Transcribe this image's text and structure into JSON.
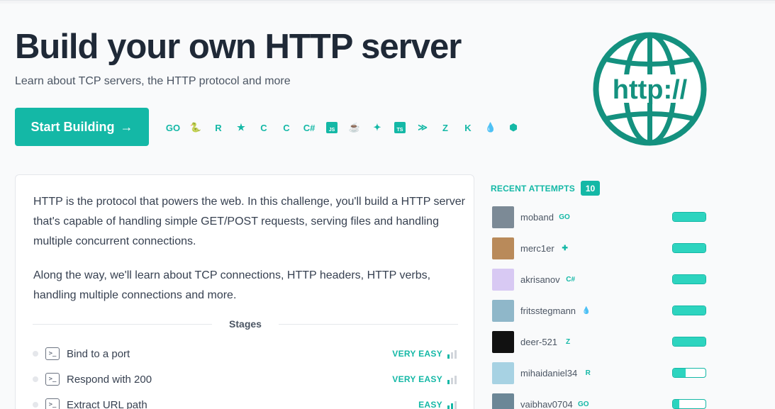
{
  "hero": {
    "title": "Build your own HTTP server",
    "subtitle": "Learn about TCP servers, the HTTP protocol and more",
    "start_button": "Start Building",
    "start_arrow": "→",
    "logo_text": "http://"
  },
  "languages": [
    {
      "name": "go-icon",
      "glyph": "GO"
    },
    {
      "name": "python-icon",
      "glyph": "🐍"
    },
    {
      "name": "rust-icon",
      "glyph": "R"
    },
    {
      "name": "haskell-icon",
      "glyph": "★"
    },
    {
      "name": "c-icon",
      "glyph": "C"
    },
    {
      "name": "cpp-icon",
      "glyph": "C"
    },
    {
      "name": "csharp-icon",
      "glyph": "C#"
    },
    {
      "name": "javascript-icon",
      "glyph": "JS"
    },
    {
      "name": "java-icon",
      "glyph": "☕"
    },
    {
      "name": "kotlin-leaf-icon",
      "glyph": "✦"
    },
    {
      "name": "typescript-icon",
      "glyph": "TS"
    },
    {
      "name": "gleam-icon",
      "glyph": "≫"
    },
    {
      "name": "zig-icon",
      "glyph": "Z"
    },
    {
      "name": "kotlin-icon",
      "glyph": "K"
    },
    {
      "name": "elixir-icon",
      "glyph": "💧"
    },
    {
      "name": "php-icon",
      "glyph": "⬢"
    }
  ],
  "description": {
    "p1": "HTTP is the protocol that powers the web. In this challenge, you'll build a HTTP server that's capable of handling simple GET/POST requests, serving files and handling multiple concurrent connections.",
    "p2": "Along the way, we'll learn about TCP connections, HTTP headers, HTTP verbs, handling multiple connections and more."
  },
  "stages": {
    "heading": "Stages",
    "items": [
      {
        "title": "Bind to a port",
        "difficulty": "VERY EASY",
        "level": 1
      },
      {
        "title": "Respond with 200",
        "difficulty": "VERY EASY",
        "level": 1
      },
      {
        "title": "Extract URL path",
        "difficulty": "EASY",
        "level": 2
      }
    ]
  },
  "recent_attempts": {
    "label": "RECENT ATTEMPTS",
    "count": "10",
    "items": [
      {
        "user": "moband",
        "lang": "go-icon",
        "glyph": "GO",
        "progress": 1.0,
        "avatar_color": "#7c8a96"
      },
      {
        "user": "merc1er",
        "lang": "python-icon",
        "glyph": "✚",
        "progress": 1.0,
        "avatar_color": "#b98a5a"
      },
      {
        "user": "akrisanov",
        "lang": "csharp-icon",
        "glyph": "C#",
        "progress": 1.0,
        "avatar_color": "#d8c9f3"
      },
      {
        "user": "fritsstegmann",
        "lang": "elixir-icon",
        "glyph": "💧",
        "progress": 1.0,
        "avatar_color": "#8fb7c9"
      },
      {
        "user": "deer-521",
        "lang": "zig-icon",
        "glyph": "Z",
        "progress": 1.0,
        "avatar_color": "#111111"
      },
      {
        "user": "mihaidaniel34",
        "lang": "rust-icon",
        "glyph": "R",
        "progress": 0.4,
        "avatar_color": "#a7d2e3"
      },
      {
        "user": "vaibhav0704",
        "lang": "go-icon",
        "glyph": "GO",
        "progress": 0.2,
        "avatar_color": "#6c8797"
      }
    ]
  },
  "colors": {
    "accent": "#14b8a6",
    "title": "#1f2937",
    "text": "#374151"
  }
}
